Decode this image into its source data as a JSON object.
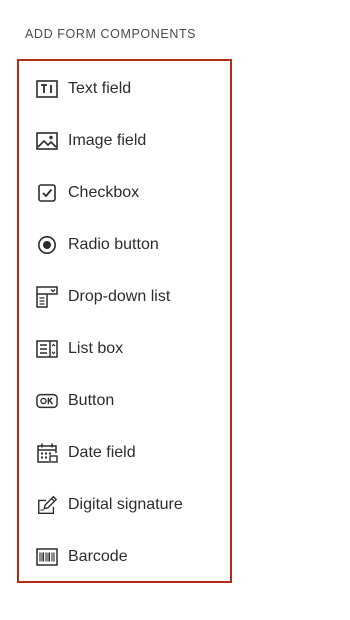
{
  "panel": {
    "section_title": "ADD FORM COMPONENTS",
    "highlight_color": "#b22d17",
    "items": [
      {
        "label": "Text field",
        "icon": "text-field-icon"
      },
      {
        "label": "Image field",
        "icon": "image-icon"
      },
      {
        "label": "Checkbox",
        "icon": "checkbox-icon"
      },
      {
        "label": "Radio button",
        "icon": "radio-button-icon"
      },
      {
        "label": "Drop-down list",
        "icon": "dropdown-list-icon"
      },
      {
        "label": "List box",
        "icon": "list-box-icon"
      },
      {
        "label": "Button",
        "icon": "ok-button-icon"
      },
      {
        "label": "Date field",
        "icon": "calendar-icon"
      },
      {
        "label": "Digital signature",
        "icon": "signature-icon"
      },
      {
        "label": "Barcode",
        "icon": "barcode-icon"
      }
    ]
  }
}
